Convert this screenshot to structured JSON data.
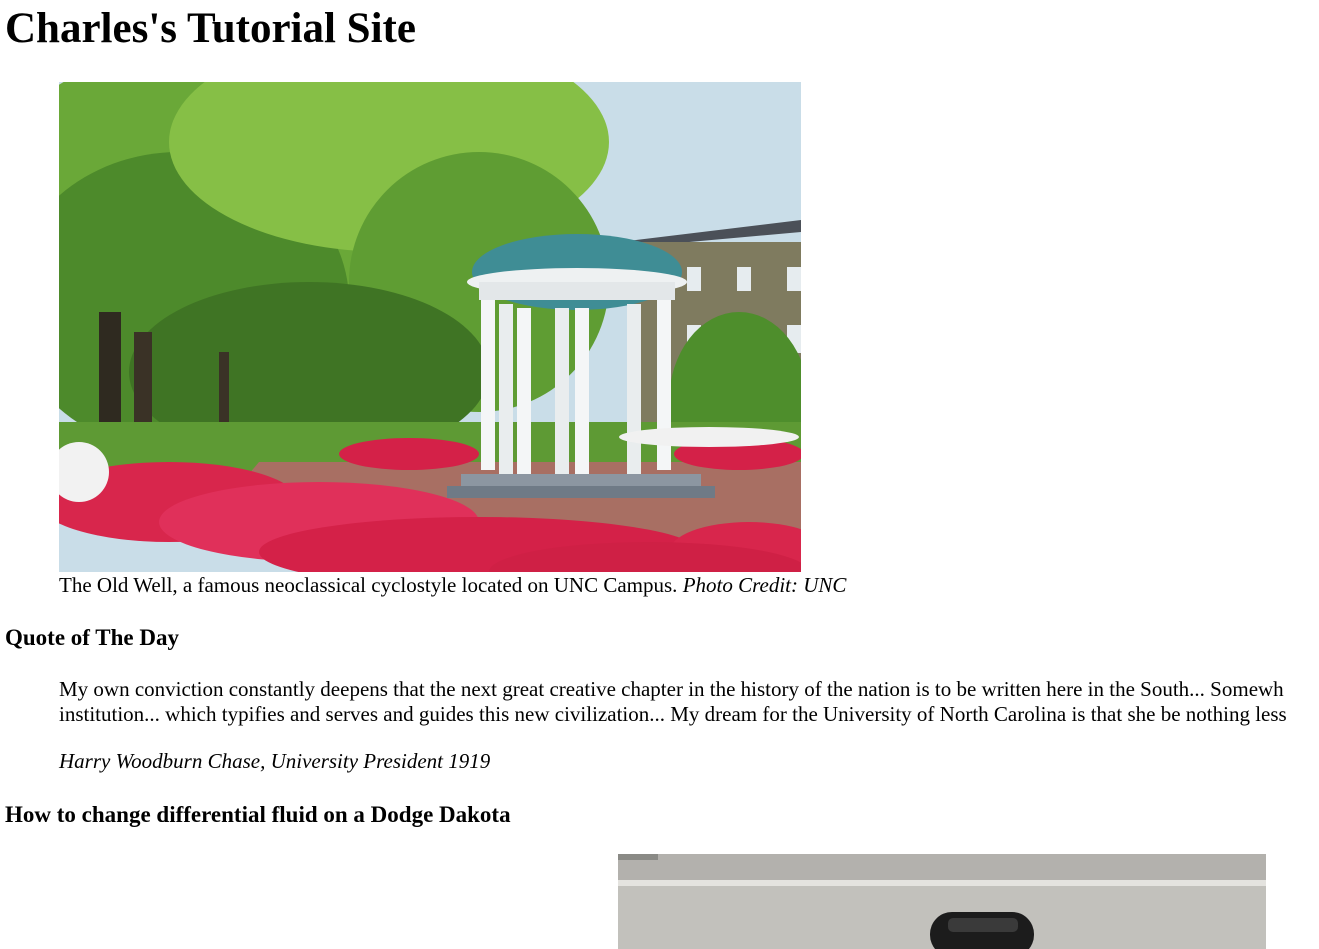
{
  "site": {
    "title": "Charles's Tutorial Site"
  },
  "figure": {
    "image_alt": "The Old Well",
    "caption_text": "The Old Well, a famous neoclassical cyclostyle located on UNC Campus.",
    "caption_credit": "Photo Credit: UNC"
  },
  "quote_section": {
    "heading": "Quote of The Day",
    "line1": "My own conviction constantly deepens that the next great creative chapter in the history of the nation is to be written here in the South... Somewh",
    "line2": "institution... which typifies and serves and guides this new civilization... My dream for the University of North Carolina is that she be nothing less",
    "attribution": "Harry Woodburn Chase, University President 1919"
  },
  "tutorial_section": {
    "heading": "How to change differential fluid on a Dodge Dakota",
    "image_alt": "Dodge Dakota"
  },
  "colors": {
    "text": "#000000",
    "background": "#ffffff"
  }
}
